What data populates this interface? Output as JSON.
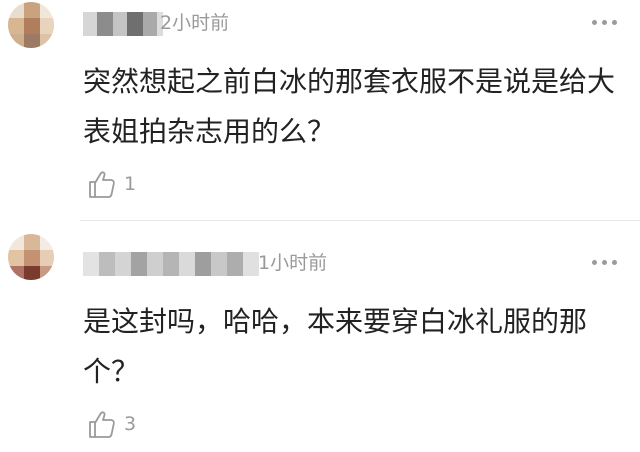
{
  "comments": [
    {
      "time": "2小时前",
      "text": "突然想起之前白冰的那套衣服不是说是给大表姐拍杂志用的么？",
      "like_count": "1",
      "colors": {
        "avatar": [
          "#d8b28e",
          "#b48a6a",
          "#e8d7c4",
          "#8a6f5e"
        ]
      }
    },
    {
      "time": "1小时前",
      "text": "是这封吗，哈哈，本来要穿白冰礼服的那个？",
      "like_count": "3",
      "colors": {
        "avatar": [
          "#e6c9a8",
          "#a86a5a",
          "#d9b8a0",
          "#7a3a2e"
        ]
      }
    }
  ],
  "icons": {
    "more": "more-dots-icon",
    "like": "thumbs-up-icon"
  },
  "colors": {
    "text": "#222222",
    "meta": "#9a9a9a",
    "divider": "#e6e6e6",
    "background": "#ffffff"
  }
}
